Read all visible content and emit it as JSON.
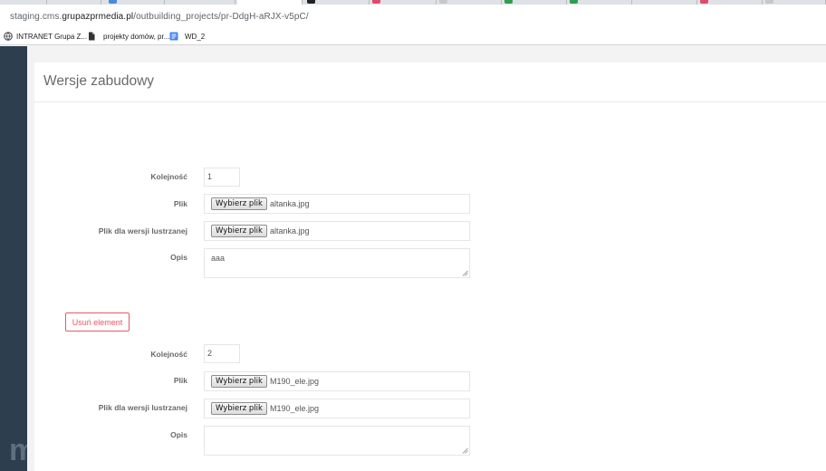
{
  "browser": {
    "url_prefix": "staging.cms.",
    "url_domain": "grupazprmedia.pl",
    "url_path": "/outbuilding_projects/pr-DdgH-aRJX-v5pC/",
    "bookmarks": [
      {
        "label": "INTRANET Grupa Z...",
        "icon": "globe-icon"
      },
      {
        "label": "projekty domów, pr...",
        "icon": "document-icon"
      },
      {
        "label": "WD_2",
        "icon": "docs-icon"
      }
    ]
  },
  "page": {
    "title": "Wersje zabudowy"
  },
  "versions": [
    {
      "order_label": "Kolejność",
      "order_value": "1",
      "file_label": "Plik",
      "file_button": "Wybierz plik",
      "file_name": "altanka.jpg",
      "mirror_label": "Plik dla wersji lustrzanej",
      "mirror_button": "Wybierz plik",
      "mirror_name": "altanka.jpg",
      "desc_label": "Opis",
      "desc_value": "aaa"
    },
    {
      "remove_label": "Usuń element",
      "order_label": "Kolejność",
      "order_value": "2",
      "file_label": "Plik",
      "file_button": "Wybierz plik",
      "file_name": "M190_ele.jpg",
      "mirror_label": "Plik dla wersji lustrzanej",
      "mirror_button": "Wybierz plik",
      "mirror_name": "M190_ele.jpg",
      "desc_label": "Opis",
      "desc_value": ""
    }
  ],
  "colors": {
    "sidebar": "#2d3e4f",
    "danger": "#ed5565",
    "panel_bg": "#ffffff",
    "page_bg": "#f3f3f3"
  }
}
